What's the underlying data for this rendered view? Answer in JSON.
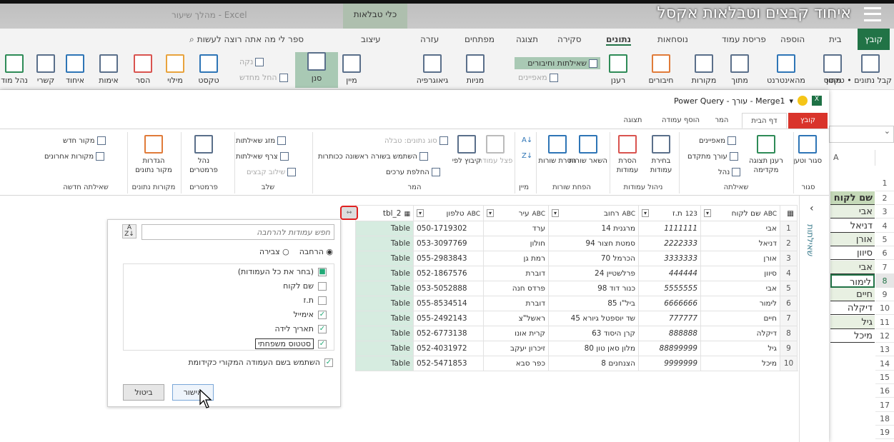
{
  "video_title": "איחוד קבצים וטבלאות אקסל",
  "excel": {
    "window_title": "מהלך שיעור - Excel",
    "contextual_tab": "כלי טבלאות",
    "tabs": [
      "קובץ",
      "בית",
      "הוספה",
      "פריסת עמוד",
      "נוסחאות",
      "נתונים",
      "סקירה",
      "תצוגה",
      "מפתחים",
      "עזרה",
      "עיצוב"
    ],
    "active_tab": "נתונים",
    "search": "ספר לי מה אתה רוצה לעשות",
    "ribbon": [
      "קבל נתונים • טקסט",
      "מתוך",
      "מהאינטרנט",
      "מתוך",
      "מקורות",
      "חיבורים",
      "רענן",
      "מניות",
      "גיאוגרפיה",
      "מיין",
      "סנן",
      "טקסט",
      "מילוי",
      "הסר",
      "אימות",
      "איחוד",
      "קשרי",
      "נהל מוד"
    ],
    "ribbon_small": [
      "שאילתות וחיבורים",
      "מאפיינים",
      "נקה",
      "החל מחדש"
    ],
    "sheet": {
      "column": "A",
      "rows": [
        "1",
        "2",
        "3",
        "4",
        "5",
        "6",
        "7",
        "8",
        "9",
        "10",
        "11",
        "12",
        "13",
        "14",
        "15",
        "16",
        "17",
        "18",
        "19"
      ],
      "cells": [
        "",
        "שם לקוח",
        "אבי",
        "דניאל",
        "אורן",
        "סיוון",
        "אבי",
        "לימור",
        "חיים",
        "דיקלה",
        "גיל",
        "מיכל"
      ]
    }
  },
  "pq": {
    "title": "Power Query - עורך - Merge1",
    "tabs": [
      "קובץ",
      "דף הבית",
      "המר",
      "הוסף עמודה",
      "תצוגה"
    ],
    "big": [
      "סגור וטען",
      "רענן תצוגה מקדימה",
      "בחירת עמודות",
      "הסרת עמודות",
      "השאר שורות",
      "הסרת שורות",
      "פצל עמודה",
      "קיבוץ לפי",
      "נהל פרמטרים",
      "הגדרות מקור נתונים"
    ],
    "small": [
      "מאפיינים",
      "עורך מתקדם",
      "נהל",
      "סוג נתונים: טבלה",
      "השתמש בשורה ראשונה ככותרות",
      "החלפת ערכים",
      "מזג שאילתות",
      "צרף שאילתות",
      "שילוב קבצים",
      "מקור חדש",
      "מקורות אחרונים"
    ],
    "groups": [
      "סגור",
      "שאילתה",
      "ניהול עמודות",
      "הפחת שורות",
      "מיין",
      "המר",
      "שלב",
      "פרמטרים",
      "מקורות נתונים",
      "שאילתה חדשה"
    ],
    "queries_label": "שאילתות",
    "columns": [
      "שם לקוח",
      "ת.ז",
      "רחוב",
      "עיר",
      "טלפון",
      "tbl_2"
    ],
    "rows": [
      [
        "אבי",
        "1111111",
        "מרגנית 14",
        "ערד",
        "050-1719302",
        "Table"
      ],
      [
        "דניאל",
        "2222333",
        "סמטת חצור 94",
        "חולון",
        "053-3097769",
        "Table"
      ],
      [
        "אורן",
        "3333333",
        "הכרמל 70",
        "רמת גן",
        "055-2983843",
        "Table"
      ],
      [
        "סיוון",
        "444444",
        "פרלשטיין 24",
        "דוברת",
        "052-1867576",
        "Table"
      ],
      [
        "אבי",
        "5555555",
        "כנור דוד 98",
        "פרדס חנה",
        "053-5052888",
        "Table"
      ],
      [
        "לימור",
        "6666666",
        "ביל\"ו 85",
        "דוברת",
        "055-8534514",
        "Table"
      ],
      [
        "חיים",
        "777777",
        "שד יוספטל גיורא 45",
        "ראשל\"צ",
        "055-2492143",
        "Table"
      ],
      [
        "דיקלה",
        "888888",
        "קרן היסוד 63",
        "קרית אונו",
        "052-6773138",
        "Table"
      ],
      [
        "גיל",
        "88899999",
        "מלון סאן טון 80",
        "זיכרון יעקב",
        "052-4031972",
        "Table"
      ],
      [
        "מיכל",
        "9999999",
        "הצנחנים 8",
        "כפר סבא",
        "052-5471853",
        "Table"
      ]
    ]
  },
  "dialog": {
    "search_placeholder": "חפש עמודות להרחבה",
    "expand": "הרחבה",
    "aggregate": "צבירה",
    "mode": "expand",
    "items": [
      {
        "label": "(בחר את כל העמודות)",
        "state": "partial"
      },
      {
        "label": "שם לקוח",
        "state": "off"
      },
      {
        "label": "ת.ז",
        "state": "off"
      },
      {
        "label": "אימייל",
        "state": "on"
      },
      {
        "label": "תאריך לידה",
        "state": "on"
      },
      {
        "label": "סטטוס משפחתי",
        "state": "on"
      }
    ],
    "prefix_label": "השתמש בשם העמודה המקורי כקידומת",
    "prefix": true,
    "ok": "אישור",
    "cancel": "ביטול"
  }
}
